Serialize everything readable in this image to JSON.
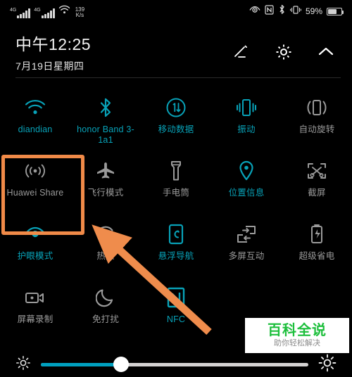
{
  "statusbar": {
    "network_type_1": "4G",
    "network_type_2": "4G",
    "net_speed_value": "139",
    "net_speed_unit": "K/s",
    "battery_percent": "59%",
    "icons": [
      "eye-comfort-icon",
      "nfc-icon",
      "bluetooth-icon",
      "vibrate-icon",
      "battery-icon"
    ]
  },
  "header": {
    "clock": "中午12:25",
    "date": "7月19日星期四",
    "actions": [
      {
        "name": "edit-button",
        "icon": "pencil-icon"
      },
      {
        "name": "settings-button",
        "icon": "gear-icon"
      },
      {
        "name": "collapse-button",
        "icon": "chevron-up-icon"
      }
    ]
  },
  "tiles": [
    [
      {
        "label": "diandian",
        "icon": "wifi-icon",
        "state": "on"
      },
      {
        "label": "honor Band 3-1a1",
        "icon": "bluetooth-icon",
        "state": "on"
      },
      {
        "label": "移动数据",
        "icon": "mobile-data-icon",
        "state": "on"
      },
      {
        "label": "振动",
        "icon": "vibrate-icon",
        "state": "on"
      },
      {
        "label": "自动旋转",
        "icon": "auto-rotate-icon",
        "state": "off"
      }
    ],
    [
      {
        "label": "Huawei Share",
        "icon": "huawei-share-icon",
        "state": "off"
      },
      {
        "label": "飞行模式",
        "icon": "airplane-icon",
        "state": "off"
      },
      {
        "label": "手电筒",
        "icon": "flashlight-icon",
        "state": "off"
      },
      {
        "label": "位置信息",
        "icon": "location-pin-icon",
        "state": "on"
      },
      {
        "label": "截屏",
        "icon": "screenshot-icon",
        "state": "off"
      }
    ],
    [
      {
        "label": "护眼模式",
        "icon": "eye-comfort-icon",
        "state": "on"
      },
      {
        "label": "热点",
        "icon": "hotspot-icon",
        "state": "off"
      },
      {
        "label": "悬浮导航",
        "icon": "floating-nav-icon",
        "state": "on"
      },
      {
        "label": "多屏互动",
        "icon": "multi-screen-icon",
        "state": "off"
      },
      {
        "label": "超级省电",
        "icon": "ultra-saver-icon",
        "state": "off"
      }
    ],
    [
      {
        "label": "屏幕录制",
        "icon": "screen-record-icon",
        "state": "off"
      },
      {
        "label": "免打扰",
        "icon": "moon-icon",
        "state": "off"
      },
      {
        "label": "NFC",
        "icon": "nfc-icon",
        "state": "on"
      },
      {
        "label": "",
        "icon": "",
        "state": "off"
      },
      {
        "label": "",
        "icon": "",
        "state": "off"
      }
    ]
  ],
  "brightness": {
    "low_icon": "brightness-low-icon",
    "high_icon": "brightness-high-icon",
    "value_percent": 30
  },
  "annotations": {
    "highlight_target": "Huawei Share",
    "arrow_target": "热点",
    "highlight_color": "#f08a48"
  },
  "watermark": {
    "title": "百科全说",
    "subtitle": "助你轻松解决",
    "color": "#1dbf3c"
  }
}
